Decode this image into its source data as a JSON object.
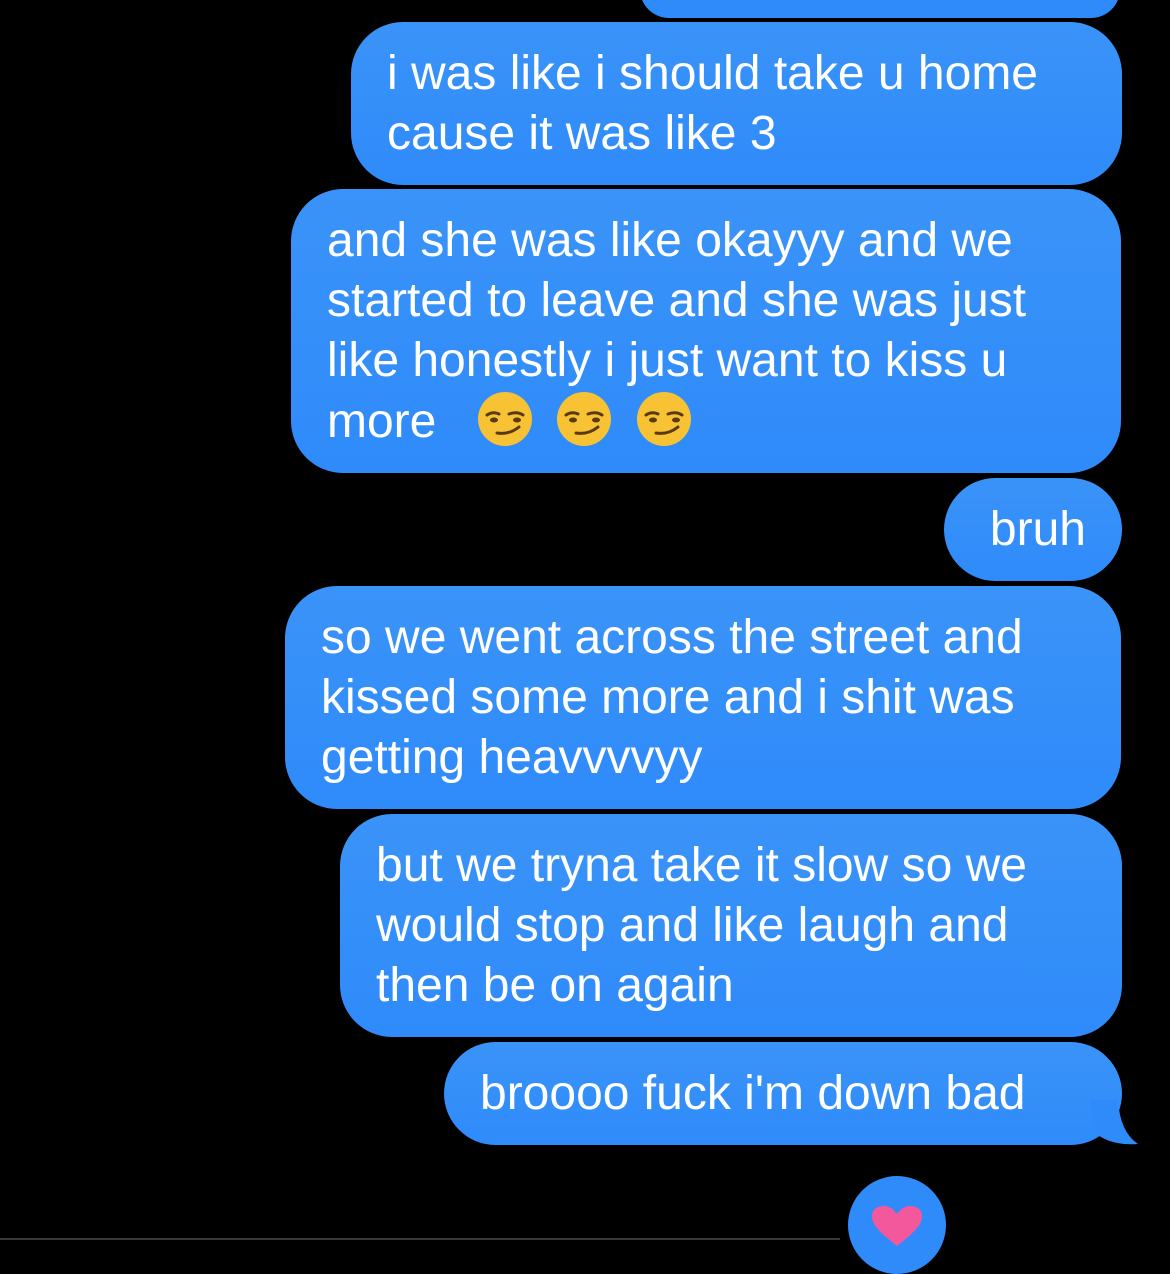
{
  "theme": {
    "background": "#000000",
    "bubble_color": "#2f8bfa",
    "text_color": "#ffffff",
    "heart_color": "#f2589b"
  },
  "messages": [
    {
      "lines": [
        "i was like i should take u home",
        "cause it was like 3"
      ]
    },
    {
      "lines": [
        "and she was like okayyy and we",
        "started to leave and she was just",
        "like honestly i just want to kiss u",
        "more"
      ],
      "emoji_count": 3,
      "emoji": "smirking-face"
    },
    {
      "lines": [
        "bruh"
      ]
    },
    {
      "lines": [
        "so we went across the street and",
        "kissed some more and i shit was",
        "getting heavvvvyy"
      ]
    },
    {
      "lines": [
        "but we tryna take it slow so we",
        "would stop and like laugh and",
        "then be on again"
      ]
    },
    {
      "lines": [
        "broooo fuck i'm down bad"
      ]
    }
  ],
  "reaction": {
    "icon": "heart-icon"
  }
}
